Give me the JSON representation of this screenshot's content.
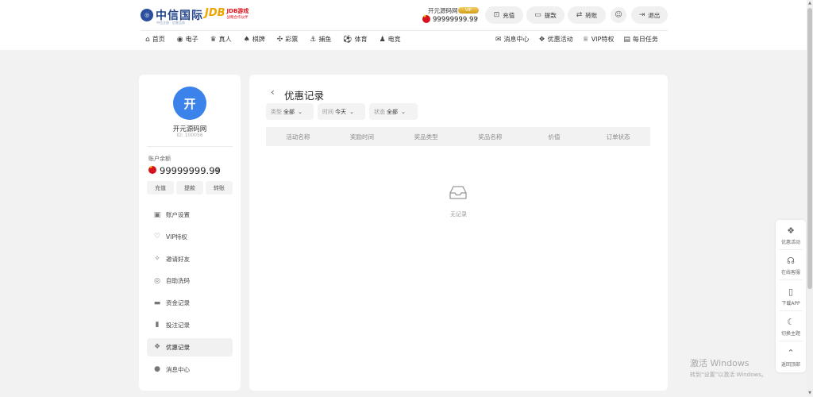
{
  "brand": {
    "logo_main": "中信国际",
    "logo_sub": "中信注册 · 信誉品质",
    "logo2_mark": "JDB",
    "logo2_title": "JDB游戏",
    "logo2_sub": "战略合作伙伴"
  },
  "user": {
    "name": "开元源码网",
    "vip_badge": "VIP",
    "balance": "99999999.99"
  },
  "header_buttons": [
    {
      "label": "充值",
      "icon": "deposit-icon"
    },
    {
      "label": "提款",
      "icon": "withdraw-icon"
    },
    {
      "label": "转账",
      "icon": "transfer-icon"
    },
    {
      "label": "退出",
      "icon": "logout-icon"
    }
  ],
  "nav": {
    "left": [
      {
        "label": "首页",
        "icon": "home-icon"
      },
      {
        "label": "电子",
        "icon": "slot-icon"
      },
      {
        "label": "真人",
        "icon": "live-icon"
      },
      {
        "label": "棋牌",
        "icon": "cards-icon"
      },
      {
        "label": "彩票",
        "icon": "lottery-icon"
      },
      {
        "label": "捕鱼",
        "icon": "fish-icon"
      },
      {
        "label": "体育",
        "icon": "sports-icon"
      },
      {
        "label": "电竞",
        "icon": "esports-icon"
      }
    ],
    "right": [
      {
        "label": "消息中心",
        "icon": "message-icon"
      },
      {
        "label": "优惠活动",
        "icon": "gift-icon"
      },
      {
        "label": "VIP特权",
        "icon": "vip-icon"
      },
      {
        "label": "每日任务",
        "icon": "task-icon"
      }
    ]
  },
  "sidebar": {
    "avatar_char": "开",
    "nickname": "开元源码网",
    "uid": "ID: 100056",
    "balance_label": "账户余额",
    "balance": "99999999.99",
    "quick_buttons": [
      "充值",
      "提款",
      "转账"
    ],
    "menu": [
      {
        "label": "账户设置",
        "icon": "account-icon",
        "active": false
      },
      {
        "label": "VIP特权",
        "icon": "vip-heart-icon",
        "active": false
      },
      {
        "label": "邀请好友",
        "icon": "invite-icon",
        "active": false
      },
      {
        "label": "自助洗码",
        "icon": "rebate-icon",
        "active": false
      },
      {
        "label": "资金记录",
        "icon": "wallet-icon",
        "active": false
      },
      {
        "label": "投注记录",
        "icon": "clipboard-icon",
        "active": false
      },
      {
        "label": "优惠记录",
        "icon": "gift-icon",
        "active": true
      },
      {
        "label": "消息中心",
        "icon": "message-icon",
        "active": false
      }
    ]
  },
  "panel": {
    "title": "优惠记录",
    "filters": [
      {
        "key": "类型",
        "value": "全部"
      },
      {
        "key": "时间",
        "value": "今天"
      },
      {
        "key": "状态",
        "value": "全部"
      }
    ],
    "columns": [
      "活动名称",
      "奖励时间",
      "奖品类型",
      "奖品名称",
      "价值",
      "订单状态"
    ],
    "empty_text": "无记录"
  },
  "float_bar": [
    {
      "label": "优惠活动",
      "icon": "gift-icon"
    },
    {
      "label": "在线客服",
      "icon": "headset-icon"
    },
    {
      "label": "下载APP",
      "icon": "phone-icon"
    },
    {
      "label": "切换主题",
      "icon": "moon-icon"
    },
    {
      "label": "返回顶部",
      "icon": "chevron-up-icon"
    }
  ],
  "watermark": {
    "line1": "激活 Windows",
    "line2": "转到“设置”以激活 Windows。"
  }
}
